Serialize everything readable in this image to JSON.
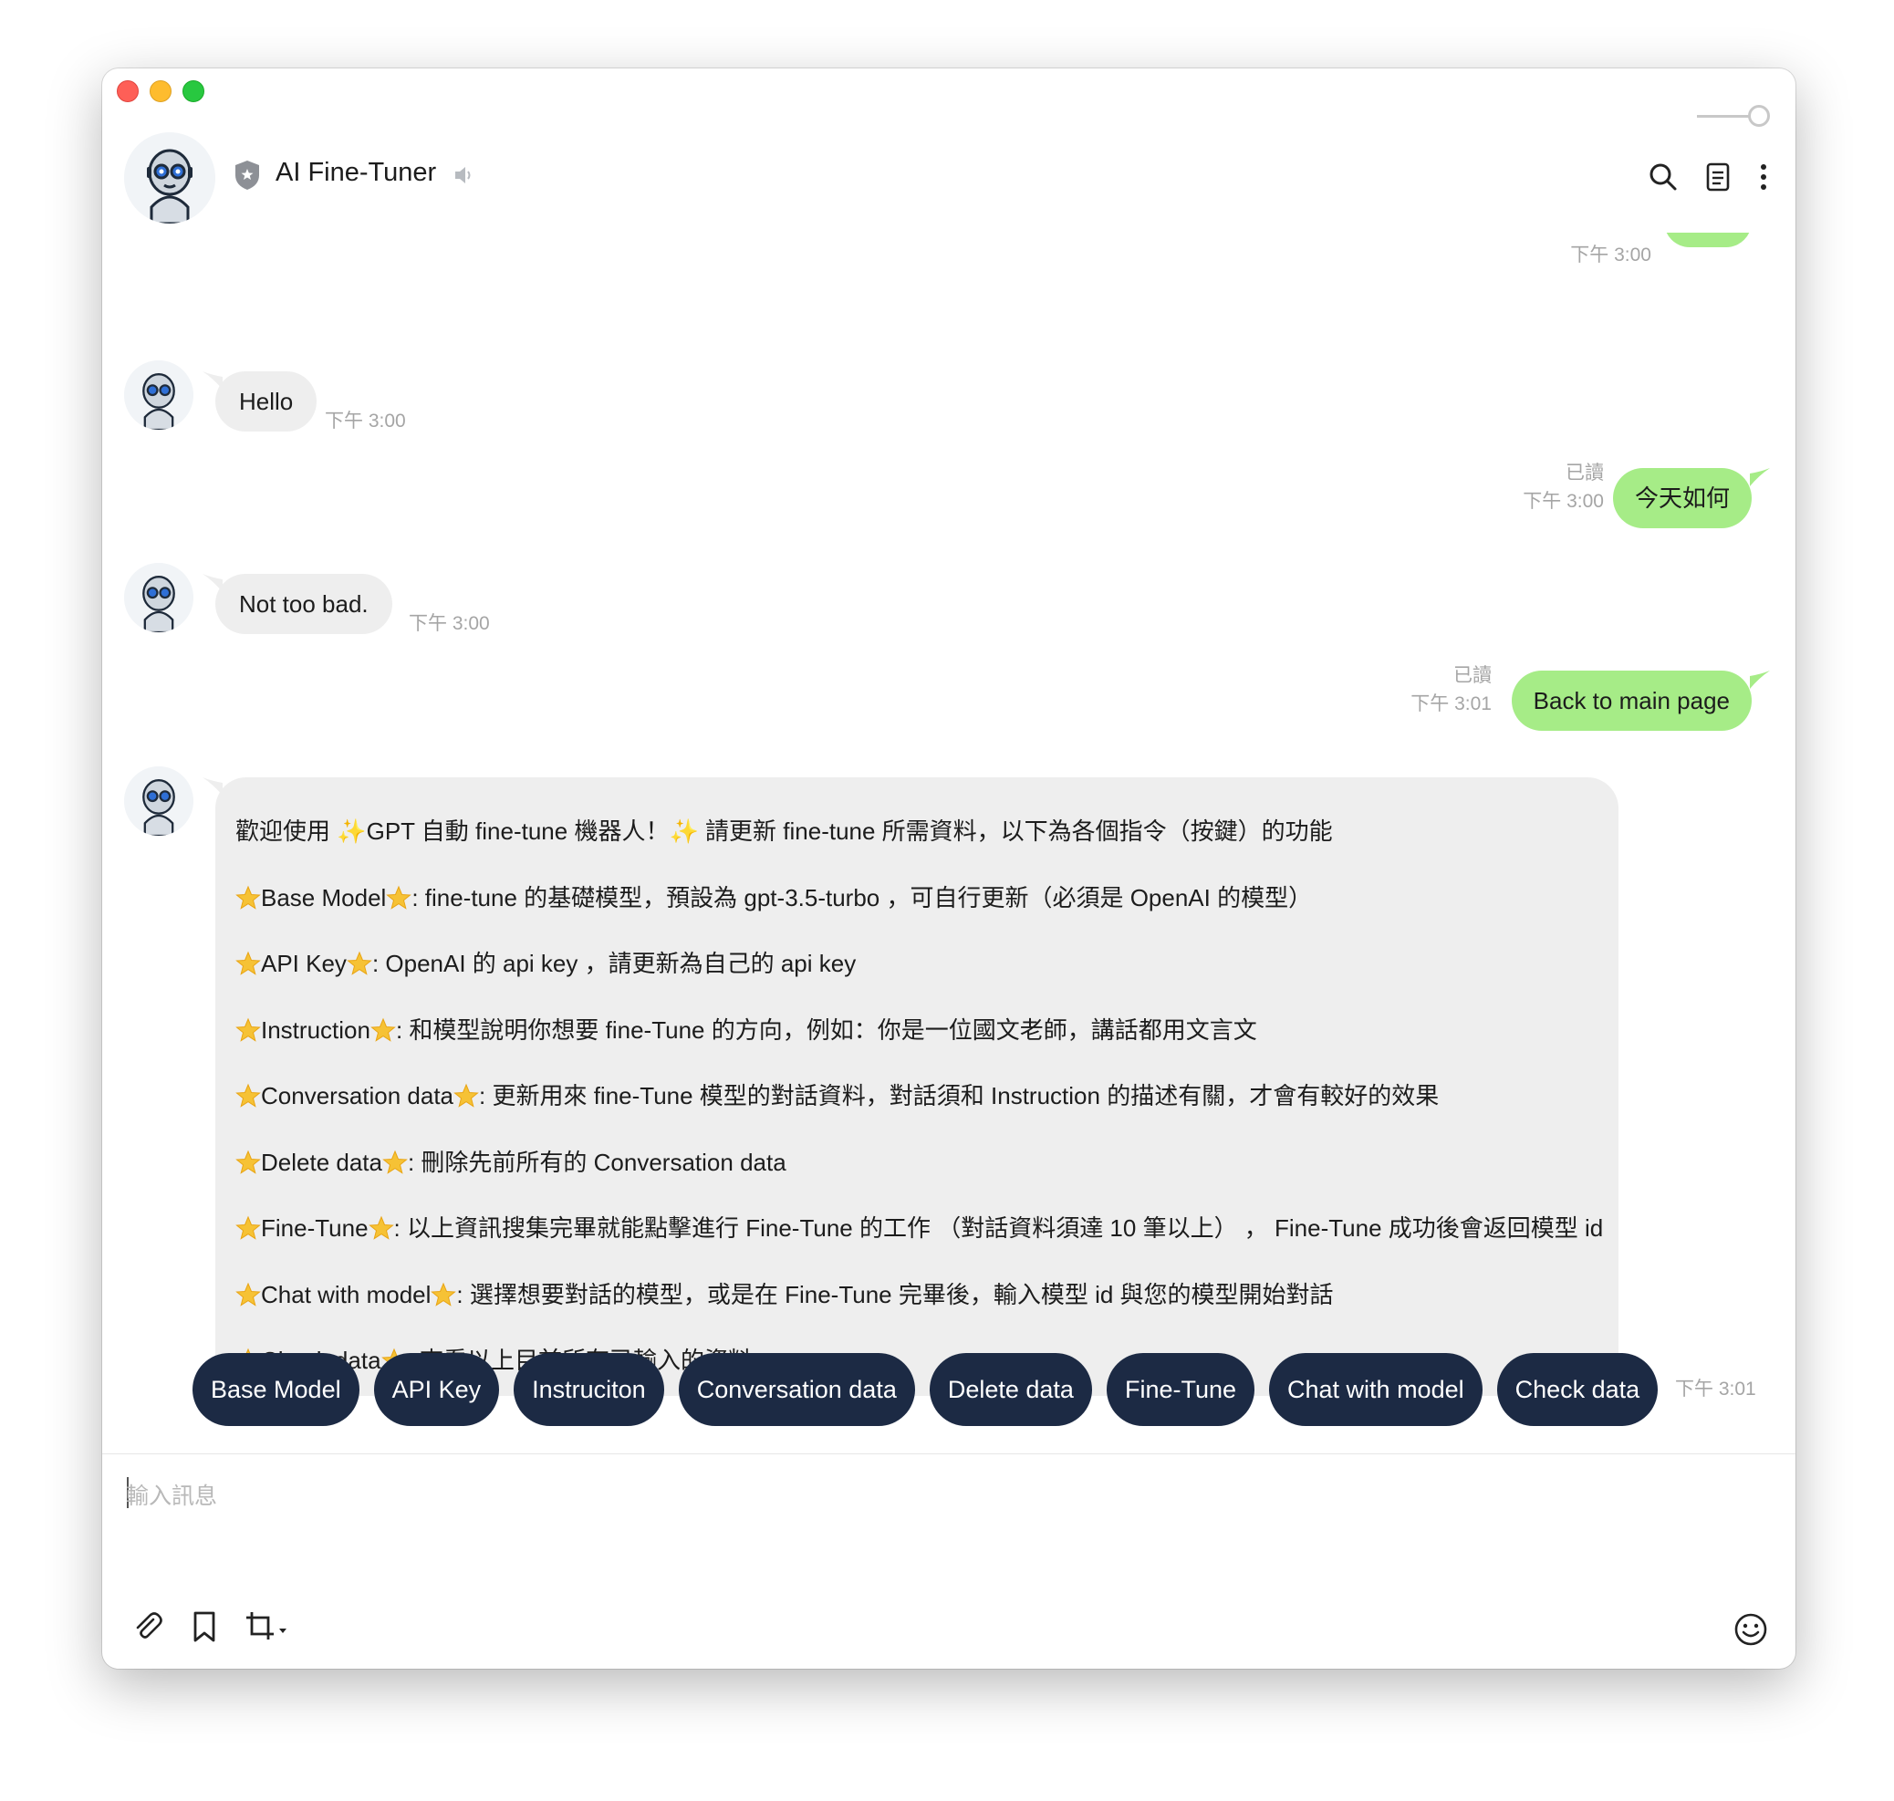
{
  "header": {
    "title": "AI Fine-Tuner"
  },
  "messages": {
    "m1": {
      "text": "Hello",
      "time": "下午 3:00"
    },
    "m2": {
      "text": "今天如何",
      "read": "已讀",
      "time": "下午 3:00"
    },
    "m3": {
      "text": "Not too bad.",
      "time": "下午 3:00"
    },
    "m4": {
      "text": "Back to main page",
      "read": "已讀",
      "time": "下午 3:01"
    },
    "partial_time": "下午 3:00"
  },
  "welcome": {
    "time": "下午 3:01",
    "intro_a": "歡迎使用 ",
    "intro_b": "GPT 自動 fine-tune 機器人！",
    "intro_c": " 請更新 fine-tune 所需資料，以下為各個指令（按鍵）的功能",
    "items": [
      {
        "name": "Base Model",
        "desc": ": fine-tune 的基礎模型，預設為 gpt-3.5-turbo ，可自行更新（必須是 OpenAI 的模型）"
      },
      {
        "name": "API Key",
        "desc": ": OpenAI 的 api key ，請更新為自己的 api key"
      },
      {
        "name": "Instruction",
        "desc": ": 和模型說明你想要 fine-Tune 的方向，例如：你是一位國文老師，講話都用文言文"
      },
      {
        "name": "Conversation data",
        "desc": ": 更新用來 fine-Tune 模型的對話資料，對話須和 Instruction 的描述有關，才會有較好的效果"
      },
      {
        "name": "Delete data",
        "desc": ": 刪除先前所有的 Conversation data"
      },
      {
        "name": "Fine-Tune",
        "desc": ": 以上資訊搜集完畢就能點擊進行 Fine-Tune 的工作 （對話資料須達 10 筆以上） ， Fine-Tune 成功後會返回模型 id"
      },
      {
        "name": "Chat with model",
        "desc": ": 選擇想要對話的模型，或是在 Fine-Tune 完畢後，輸入模型 id 與您的模型開始對話"
      },
      {
        "name": "Check data",
        "desc": ": 查看以上目前所有已輸入的資料"
      }
    ]
  },
  "quick_replies": [
    "Base Model",
    "API Key",
    "Instruciton",
    "Conversation data",
    "Delete data",
    "Fine-Tune",
    "Chat with model",
    "Check data"
  ],
  "composer": {
    "placeholder": "輸入訊息"
  },
  "colors": {
    "accent_green": "#a6ec87",
    "button_navy": "#1c2a44",
    "bubble_gray": "#eeeeee"
  }
}
